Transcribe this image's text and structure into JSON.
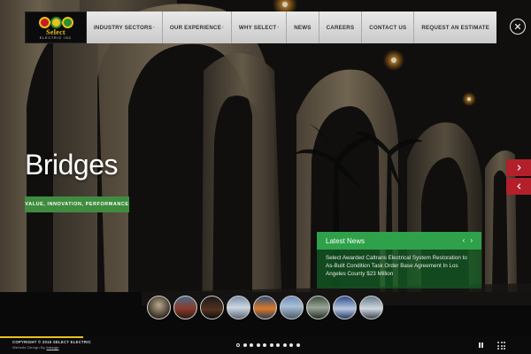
{
  "brand": {
    "logo_name": "Select",
    "logo_sub": "ELECTRIC INC",
    "colors": {
      "red": "#c91d1d",
      "yellow": "#e8c21d",
      "green": "#2d8d32"
    }
  },
  "nav": {
    "items": [
      {
        "label": "INDUSTRY SECTORS",
        "has_dropdown": true
      },
      {
        "label": "OUR EXPERIENCE",
        "has_dropdown": true
      },
      {
        "label": "WHY SELECT",
        "has_dropdown": true
      },
      {
        "label": "NEWS",
        "has_dropdown": false
      },
      {
        "label": "CAREERS",
        "has_dropdown": false
      },
      {
        "label": "CONTACT US",
        "has_dropdown": false
      },
      {
        "label": "REQUEST AN ESTIMATE",
        "has_dropdown": false
      }
    ],
    "caret": "-"
  },
  "hero": {
    "headline": "Bridges",
    "tagline": "VALUE, INNOVATION, PERFORMANCE",
    "tagline_color": "#3f8c3f"
  },
  "side_arrows": {
    "up_icon": "chevron-right-icon",
    "down_icon": "chevron-left-icon",
    "color": "#b3202a"
  },
  "news": {
    "title": "Latest News",
    "prev": "‹",
    "next": "›",
    "text": "Select Awarded Caltrans Electrical System Restoration to As-Built Condition Task Order Base Agreement In Los Angeles County $23 Million",
    "accent": "#2ea14a"
  },
  "thumbnails": [
    {
      "name": "thumbnail-1"
    },
    {
      "name": "thumbnail-2"
    },
    {
      "name": "thumbnail-3"
    },
    {
      "name": "thumbnail-4"
    },
    {
      "name": "thumbnail-5"
    },
    {
      "name": "thumbnail-6"
    },
    {
      "name": "thumbnail-7"
    },
    {
      "name": "thumbnail-8"
    },
    {
      "name": "thumbnail-9"
    }
  ],
  "footer": {
    "copyright": "COPYRIGHT © 2015 SELECT ELECTRIC",
    "credit_prefix": "Website Design By",
    "credit_link": "inesign"
  },
  "slides": {
    "count": 10,
    "active_index": 0
  }
}
